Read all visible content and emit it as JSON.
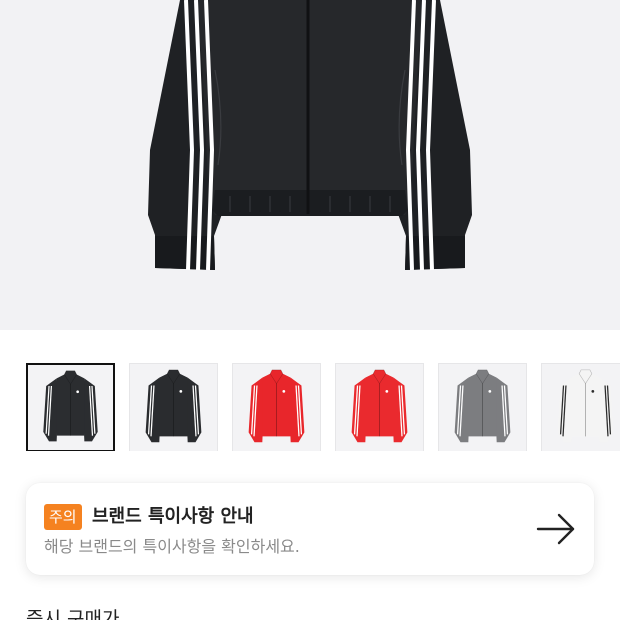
{
  "product": {
    "main_image_icon": "black-track-jacket-image",
    "background_color": "#f2f2f4"
  },
  "thumbnails": [
    {
      "icon": "black-jacket-thumbnail",
      "color": "#2b2d30",
      "stripe": "#ffffff",
      "selected": true
    },
    {
      "icon": "black-jacket-thumbnail",
      "color": "#2a2c2f",
      "stripe": "#ffffff",
      "selected": false
    },
    {
      "icon": "red-jacket-thumbnail",
      "color": "#e8262b",
      "stripe": "#ffffff",
      "selected": false
    },
    {
      "icon": "red-jacket-thumbnail",
      "color": "#ea2a2e",
      "stripe": "#ffffff",
      "selected": false
    },
    {
      "icon": "grey-jacket-thumbnail",
      "color": "#7c7d80",
      "stripe": "#ffffff",
      "selected": false
    },
    {
      "icon": "white-jacket-thumbnail",
      "color": "#f4f4f4",
      "stripe": "#2c2c2c",
      "selected": false
    }
  ],
  "notice": {
    "badge": "주의",
    "title": "브랜드 특이사항 안내",
    "description": "해당 브랜드의 특이사항을 확인하세요.",
    "arrow_icon": "arrow-right-icon",
    "badge_color": "#f58220"
  },
  "section": {
    "label": "즉시 구매가"
  }
}
